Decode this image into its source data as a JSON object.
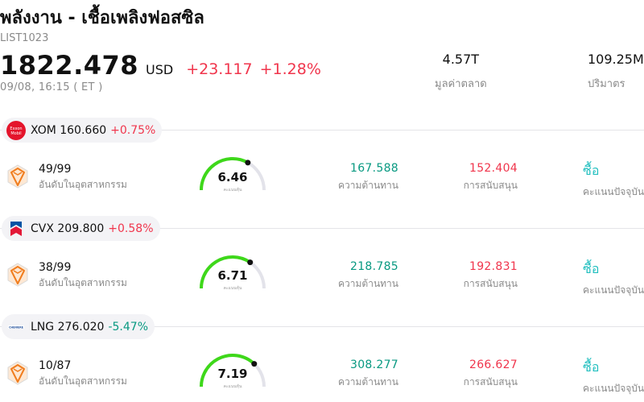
{
  "header": {
    "title": "พลังงาน - เชื้อเพลิงฟอสซิล",
    "list_id": "LIST1023",
    "price": "1822.478",
    "currency": "USD",
    "change": "+23.117",
    "change_pct": "+1.28%",
    "timestamp": "09/08, 16:15  ( ET )",
    "market_cap_value": "4.57T",
    "market_cap_label": "มูลค่าตลาด",
    "volume_value": "109.25M",
    "volume_label": "ปริมาตร"
  },
  "colors": {
    "up": "#f0354c",
    "down": "#089981",
    "gauge_green": "#3ed81a",
    "rating": "#22bfbf"
  },
  "stocks": [
    {
      "ticker_line": "XOM 160.660",
      "pct": "+0.75%",
      "direction": "up",
      "logo": "exxon-mobil-logo",
      "logo_text": "Exxon Mobil",
      "rank": "49/99",
      "rank_label": "อันดับในอุตสาหกรรม",
      "score": "6.46",
      "score_fraction": 0.646,
      "score_label": "คะแนนหุ้น",
      "resistance": "167.588",
      "resistance_label": "ความต้านทาน",
      "support": "152.404",
      "support_label": "การสนับสนุน",
      "rating": "ซื้อ",
      "rating_label": "คะแนนปัจจุบัน"
    },
    {
      "ticker_line": "CVX 209.800",
      "pct": "+0.58%",
      "direction": "up",
      "logo": "chevron-logo",
      "logo_text": "",
      "rank": "38/99",
      "rank_label": "อันดับในอุตสาหกรรม",
      "score": "6.71",
      "score_fraction": 0.671,
      "score_label": "คะแนนหุ้น",
      "resistance": "218.785",
      "resistance_label": "ความต้านทาน",
      "support": "192.831",
      "support_label": "การสนับสนุน",
      "rating": "ซื้อ",
      "rating_label": "คะแนนปัจจุบัน"
    },
    {
      "ticker_line": "LNG 276.020",
      "pct": "-5.47%",
      "direction": "down",
      "logo": "cheniere-logo",
      "logo_text": "CHENIERE",
      "rank": "10/87",
      "rank_label": "อันดับในอุตสาหกรรม",
      "score": "7.19",
      "score_fraction": 0.719,
      "score_label": "คะแนนหุ้น",
      "resistance": "308.277",
      "resistance_label": "ความต้านทาน",
      "support": "266.627",
      "support_label": "การสนับสนุน",
      "rating": "ซื้อ",
      "rating_label": "คะแนนปัจจุบัน"
    }
  ]
}
